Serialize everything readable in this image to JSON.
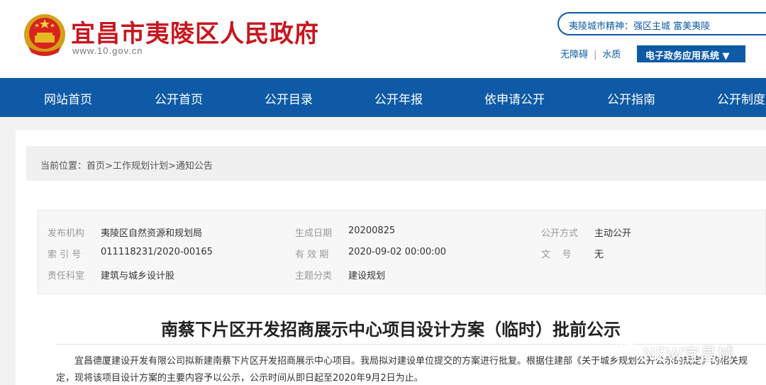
{
  "header": {
    "site_title": "宜昌市夷陵区人民政府",
    "site_url": "www.10.gov.cn",
    "slogan": "夷陵城市精神：强区主城  富美夷陵",
    "link_accessible": "无障碍",
    "link_separator": "|",
    "link_water": "水质",
    "eservice_label": "电子政务应用系统 ▼"
  },
  "colors": {
    "brand_blue": "#0e5aa6",
    "brand_red": "#c8161e"
  },
  "nav": {
    "items": [
      "网站首页",
      "公开首页",
      "公开目录",
      "公开年报",
      "依申请公开",
      "公开指南",
      "公开制度"
    ]
  },
  "breadcrumb": {
    "prefix": "当前位置：",
    "items": [
      "首页",
      "工作规划计划",
      "通知公告"
    ],
    "separator": ">"
  },
  "meta": {
    "publisher_label": "发布机构",
    "publisher": "夷陵区自然资源和规划局",
    "generated_label": "生成日期",
    "generated": "20200825",
    "open_mode_label": "公开方式",
    "open_mode": "主动公开",
    "index_label": "索 引 号",
    "index": "011118231/2020-00165",
    "valid_label": "有 效 期",
    "valid": "2020-09-02 00:00:00",
    "doc_no_label": "文    号",
    "doc_no": "无",
    "dept_label": "责任科室",
    "dept": "建筑与城乡设计股",
    "topic_label": "主题分类",
    "topic": "建设规划"
  },
  "article": {
    "title": "南蔡下片区开发招商展示中心项目设计方案（临时）批前公示",
    "paragraph": "宜昌德厦建设开发有限公司拟新建南蔡下片区开发招商展示中心项目。我局拟对建设单位提交的方案进行批复。根据住建部《关于城乡规划公开公示的规定》的相关规定，现将该项目设计方案的主要内容予以公示，公示时间从即日起至2020年9月2日为止。"
  },
  "watermark": {
    "text": "NEW宜昌城",
    "icon": "wechat-icon"
  }
}
